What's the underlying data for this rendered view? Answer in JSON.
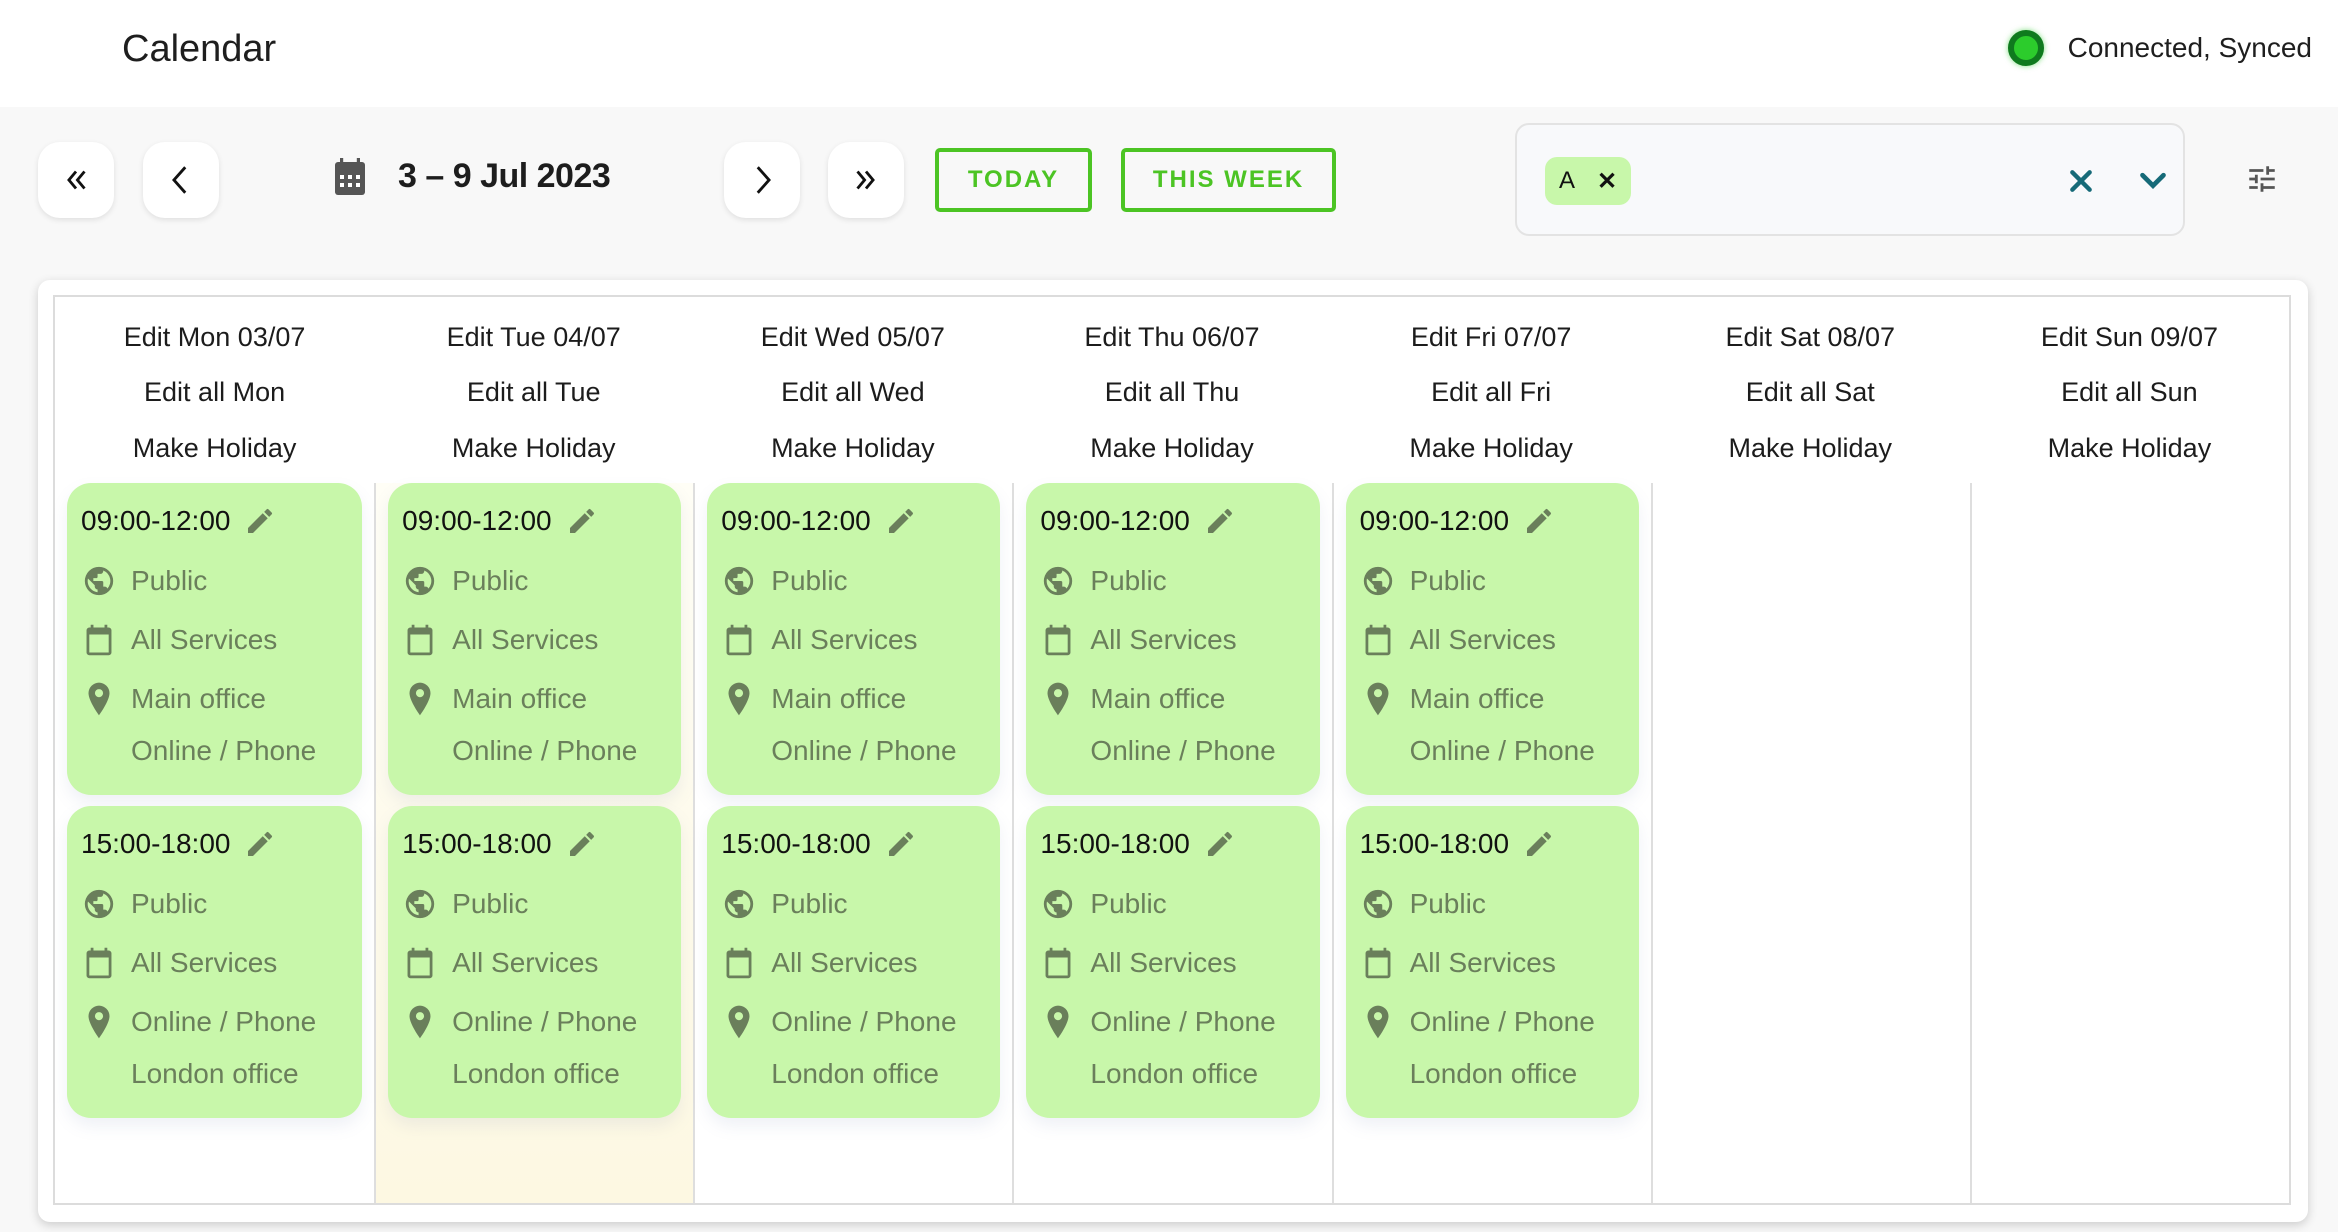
{
  "header": {
    "title": "Calendar",
    "status_text": "Connected, Synced",
    "status_color": "#2ccc2c"
  },
  "toolbar": {
    "first_icon": "double-chevron-left-icon",
    "prev_icon": "chevron-left-icon",
    "next_icon": "chevron-right-icon",
    "last_icon": "double-chevron-right-icon",
    "date_range": "3 – 9 Jul 2023",
    "today_label": "TODAY",
    "this_week_label": "THIS WEEK",
    "accent_color": "#4cc424",
    "filter": {
      "chips": [
        {
          "label": "A"
        }
      ],
      "clear_icon": "close-icon",
      "dropdown_icon": "chevron-down-icon"
    },
    "settings_icon": "tune-icon"
  },
  "calendar": {
    "days": [
      {
        "edit_day": "Edit Mon 03/07",
        "edit_all": "Edit all Mon",
        "holiday": "Make Holiday",
        "today": false,
        "slots": [
          {
            "time": "09:00-12:00",
            "visibility": "Public",
            "services": "All Services",
            "locations": [
              "Main office",
              "Online / Phone"
            ]
          },
          {
            "time": "15:00-18:00",
            "visibility": "Public",
            "services": "All Services",
            "locations": [
              "Online / Phone",
              "London office"
            ]
          }
        ]
      },
      {
        "edit_day": "Edit Tue 04/07",
        "edit_all": "Edit all Tue",
        "holiday": "Make Holiday",
        "today": true,
        "slots": [
          {
            "time": "09:00-12:00",
            "visibility": "Public",
            "services": "All Services",
            "locations": [
              "Main office",
              "Online / Phone"
            ]
          },
          {
            "time": "15:00-18:00",
            "visibility": "Public",
            "services": "All Services",
            "locations": [
              "Online / Phone",
              "London office"
            ]
          }
        ]
      },
      {
        "edit_day": "Edit Wed 05/07",
        "edit_all": "Edit all Wed",
        "holiday": "Make Holiday",
        "today": false,
        "slots": [
          {
            "time": "09:00-12:00",
            "visibility": "Public",
            "services": "All Services",
            "locations": [
              "Main office",
              "Online / Phone"
            ]
          },
          {
            "time": "15:00-18:00",
            "visibility": "Public",
            "services": "All Services",
            "locations": [
              "Online / Phone",
              "London office"
            ]
          }
        ]
      },
      {
        "edit_day": "Edit Thu 06/07",
        "edit_all": "Edit all Thu",
        "holiday": "Make Holiday",
        "today": false,
        "slots": [
          {
            "time": "09:00-12:00",
            "visibility": "Public",
            "services": "All Services",
            "locations": [
              "Main office",
              "Online / Phone"
            ]
          },
          {
            "time": "15:00-18:00",
            "visibility": "Public",
            "services": "All Services",
            "locations": [
              "Online / Phone",
              "London office"
            ]
          }
        ]
      },
      {
        "edit_day": "Edit Fri 07/07",
        "edit_all": "Edit all Fri",
        "holiday": "Make Holiday",
        "today": false,
        "slots": [
          {
            "time": "09:00-12:00",
            "visibility": "Public",
            "services": "All Services",
            "locations": [
              "Main office",
              "Online / Phone"
            ]
          },
          {
            "time": "15:00-18:00",
            "visibility": "Public",
            "services": "All Services",
            "locations": [
              "Online / Phone",
              "London office"
            ]
          }
        ]
      },
      {
        "edit_day": "Edit Sat 08/07",
        "edit_all": "Edit all Sat",
        "holiday": "Make Holiday",
        "today": false,
        "slots": []
      },
      {
        "edit_day": "Edit Sun 09/07",
        "edit_all": "Edit all Sun",
        "holiday": "Make Holiday",
        "today": false,
        "slots": []
      }
    ],
    "slot_color": "#c8f7aa",
    "slot_text_color": "#6a7f5b",
    "today_color": "#fdf8e2"
  }
}
